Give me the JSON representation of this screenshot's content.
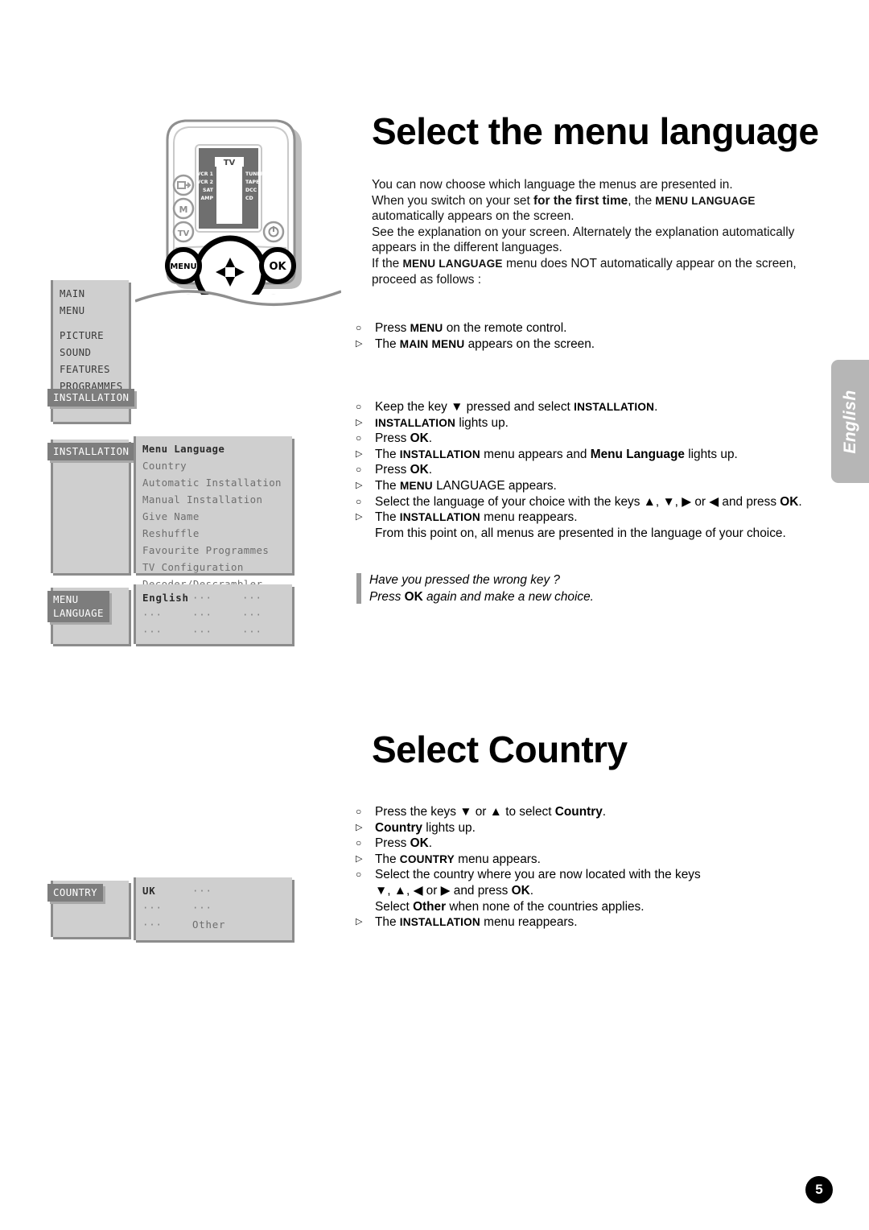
{
  "page": {
    "number": "5",
    "side_tab": "English"
  },
  "section_language": {
    "title": "Select the menu language",
    "intro": [
      {
        "text": "You can now choose which language the menus are presented in."
      },
      {
        "pre": "When you switch on your set ",
        "bold": "for the first time",
        "mid": ", the ",
        "sc": "MENU LANGUAGE"
      },
      {
        "text": "automatically appears on the screen."
      },
      {
        "text": "See the explanation on your screen.  Alternately the explanation automatically"
      },
      {
        "text": "appears in the different languages."
      },
      {
        "pre": "If the ",
        "sc": "MENU LANGUAGE",
        "post": " menu does NOT automatically appear on the screen,"
      },
      {
        "text": "proceed as follows :"
      }
    ],
    "steps_group1": [
      {
        "bullet": "circle",
        "text": "Press MENU on the remote control."
      },
      {
        "bullet": "triangle",
        "text": "The MAIN MENU appears on the screen."
      }
    ],
    "steps_group2": [
      {
        "bullet": "circle",
        "text": "Keep the key ▼ pressed and select INSTALLATION."
      },
      {
        "bullet": "triangle",
        "text": "INSTALLATION lights up."
      },
      {
        "bullet": "circle",
        "text": "Press OK."
      },
      {
        "bullet": "triangle",
        "text": "The INSTALLATION menu appears and Menu Language lights up."
      },
      {
        "bullet": "circle",
        "text": "Press OK."
      },
      {
        "bullet": "triangle",
        "text": "The MENU LANGUAGE appears."
      },
      {
        "bullet": "circle",
        "text": "Select the language of your choice with the keys ▲, ▼, ▶ or ◀ and press OK."
      },
      {
        "bullet": "triangle",
        "text": "The INSTALLATION menu reappears."
      },
      {
        "bullet": "none",
        "text": "From this point on, all menus are presented in the language of your choice."
      }
    ],
    "note_line1": "Have you pressed the wrong key ?",
    "note_line2_pre": "Press ",
    "note_line2_bold": "OK",
    "note_line2_post": " again and make a new choice."
  },
  "section_country": {
    "title": "Select Country",
    "steps": [
      {
        "bullet": "circle",
        "text": "Press the keys ▼ or ▲  to select Country."
      },
      {
        "bullet": "triangle",
        "text": "Country lights up."
      },
      {
        "bullet": "circle",
        "text": "Press OK."
      },
      {
        "bullet": "triangle",
        "text": "The COUNTRY menu appears."
      },
      {
        "bullet": "circle",
        "text": "Select the country where you are now located with the keys"
      },
      {
        "bullet": "indent",
        "text": "▼, ▲, ◀ or ▶ and press OK."
      },
      {
        "bullet": "indent0",
        "text": "Select Other when none of the countries applies."
      },
      {
        "bullet": "triangle",
        "text": "The INSTALLATION menu reappears."
      }
    ]
  },
  "osd": {
    "main_menu": {
      "header_line1": "MAIN",
      "header_line2": "MENU",
      "items": [
        "PICTURE",
        "SOUND",
        "FEATURES",
        "PROGRAMMES"
      ],
      "highlighted": "INSTALLATION"
    },
    "installation": {
      "tab": "INSTALLATION",
      "items": [
        "Menu Language",
        "Country",
        "Automatic Installation",
        "Manual Installation",
        "Give Name",
        "Reshuffle",
        "Favourite Programmes",
        "TV Configuration",
        "Decoder/Descrambler"
      ],
      "selected": "Menu Language"
    },
    "menu_language": {
      "tab_line1": "MENU",
      "tab_line2": "LANGUAGE",
      "grid": [
        [
          "English",
          "···",
          "···"
        ],
        [
          "···",
          "···",
          "···"
        ],
        [
          "···",
          "···",
          "···"
        ]
      ],
      "selected": "English"
    },
    "country": {
      "tab": "COUNTRY",
      "grid": [
        [
          "UK",
          "···",
          ""
        ],
        [
          "···",
          "···",
          ""
        ],
        [
          "···",
          "Other",
          ""
        ]
      ],
      "selected": "UK"
    }
  },
  "remote": {
    "lcd_top": "TV",
    "lcd_left": [
      "VCR 1",
      "VCR 2",
      "SAT",
      "AMP"
    ],
    "lcd_right": [
      "TUNER",
      "TAPE",
      "DCC",
      "CD"
    ],
    "buttons": {
      "exit": "exit-icon",
      "m": "M",
      "tv": "TV",
      "power": "power-icon",
      "menu": "MENU",
      "ok": "OK",
      "plus_left": "+",
      "plus_right": "+"
    }
  },
  "colors": {
    "osd_bg": "#cfcfcf",
    "osd_highlight": "#7d7d7d",
    "tab_gray": "#b6b6b6",
    "note_bar": "#9b9b9b"
  }
}
